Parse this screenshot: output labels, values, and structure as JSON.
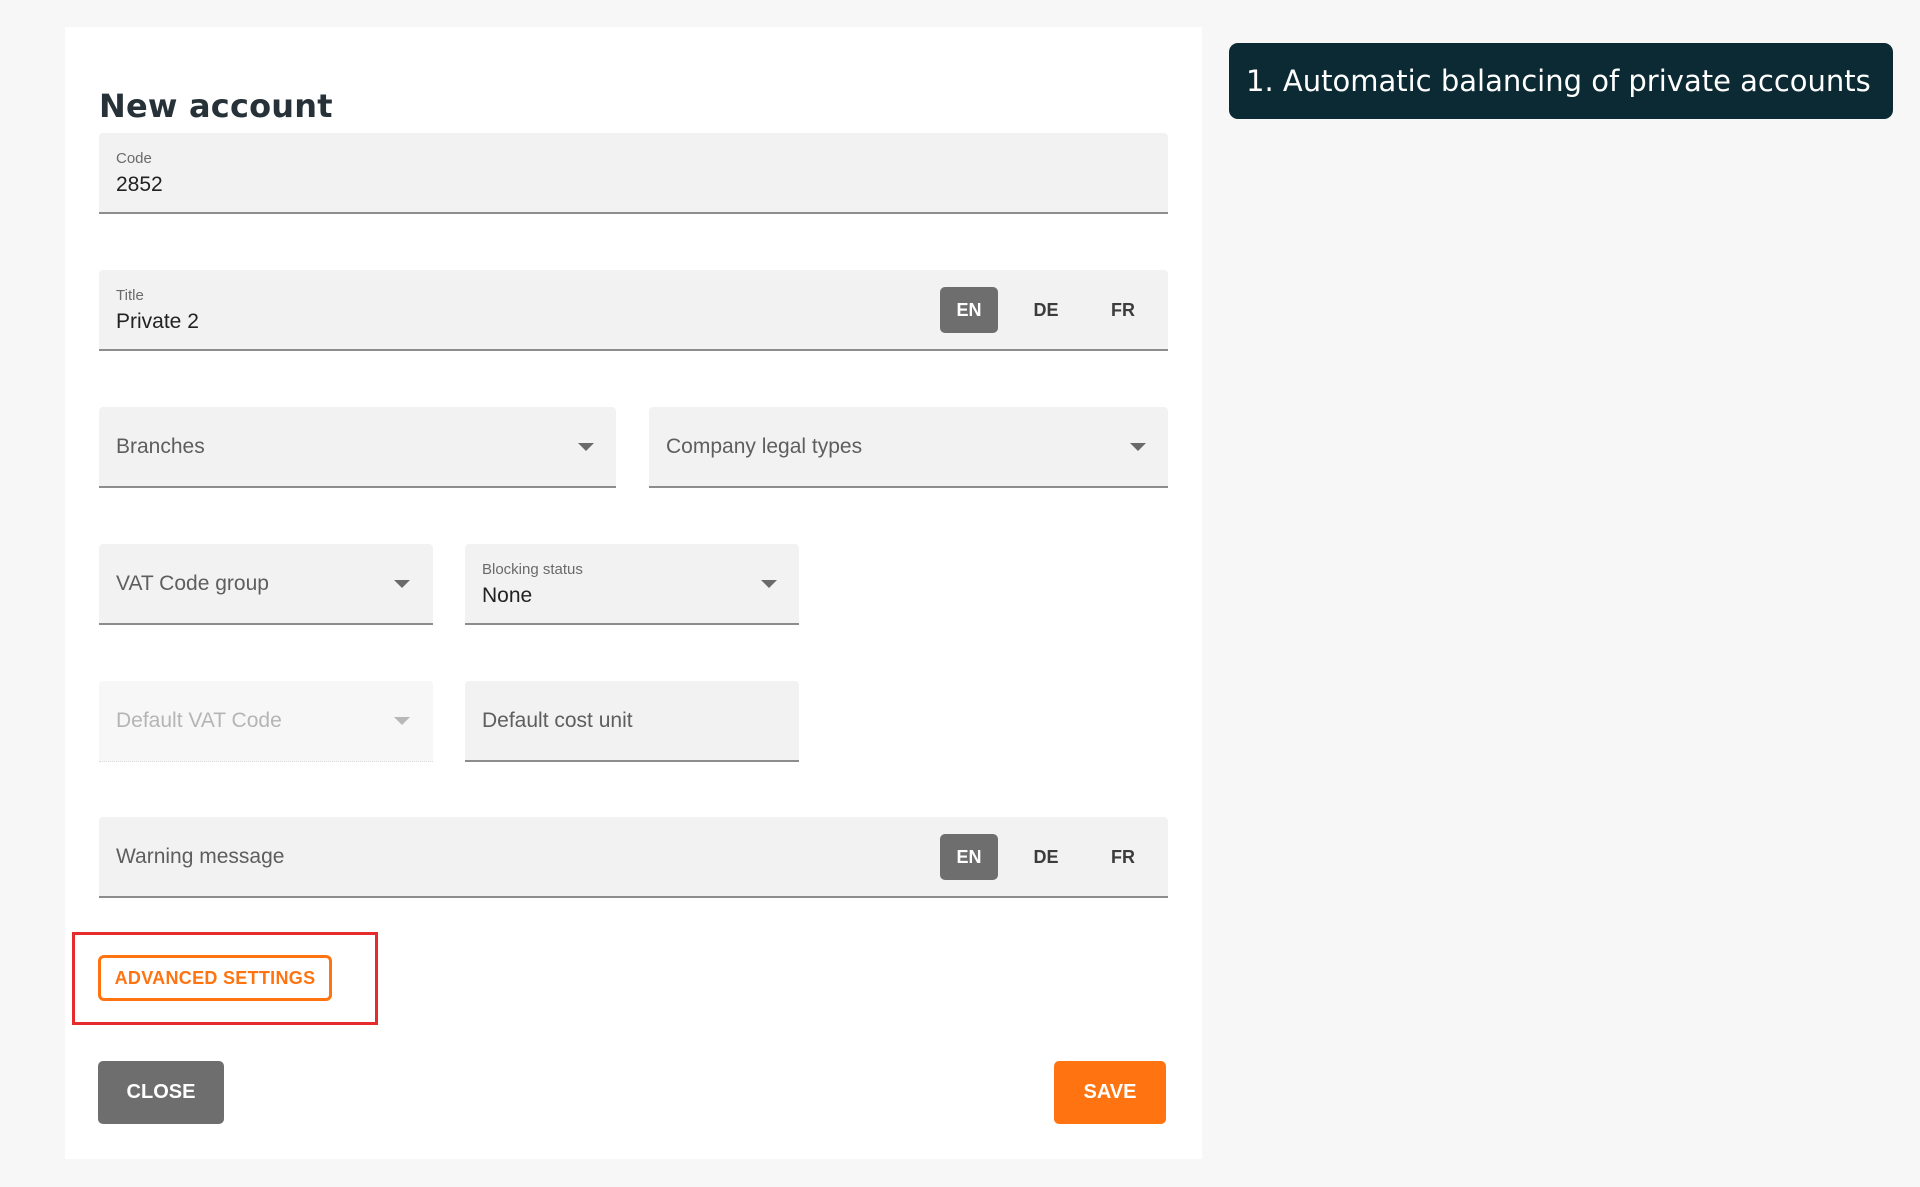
{
  "dialog": {
    "title": "New account"
  },
  "code": {
    "label": "Code",
    "value": "2852"
  },
  "title_field": {
    "label": "Title",
    "value": "Private 2",
    "languages": [
      "EN",
      "DE",
      "FR"
    ],
    "active_language": "EN"
  },
  "branches": {
    "placeholder": "Branches"
  },
  "company_legal_types": {
    "placeholder": "Company legal types"
  },
  "vat_code_group": {
    "placeholder": "VAT Code group"
  },
  "blocking_status": {
    "label": "Blocking status",
    "value": "None"
  },
  "default_vat_code": {
    "placeholder": "Default VAT Code",
    "disabled": true
  },
  "default_cost_unit": {
    "placeholder": "Default cost unit"
  },
  "warning_message": {
    "placeholder": "Warning message",
    "languages": [
      "EN",
      "DE",
      "FR"
    ],
    "active_language": "EN"
  },
  "buttons": {
    "advanced_settings": "ADVANCED SETTINGS",
    "close": "CLOSE",
    "save": "SAVE"
  },
  "callout": {
    "text": "1.  Automatic balancing of private accounts"
  },
  "colors": {
    "accent": "#ff7410",
    "highlight": "#e52b2b",
    "callout_bg": "#0b2a33",
    "neutral_button": "#6e6e6e"
  }
}
